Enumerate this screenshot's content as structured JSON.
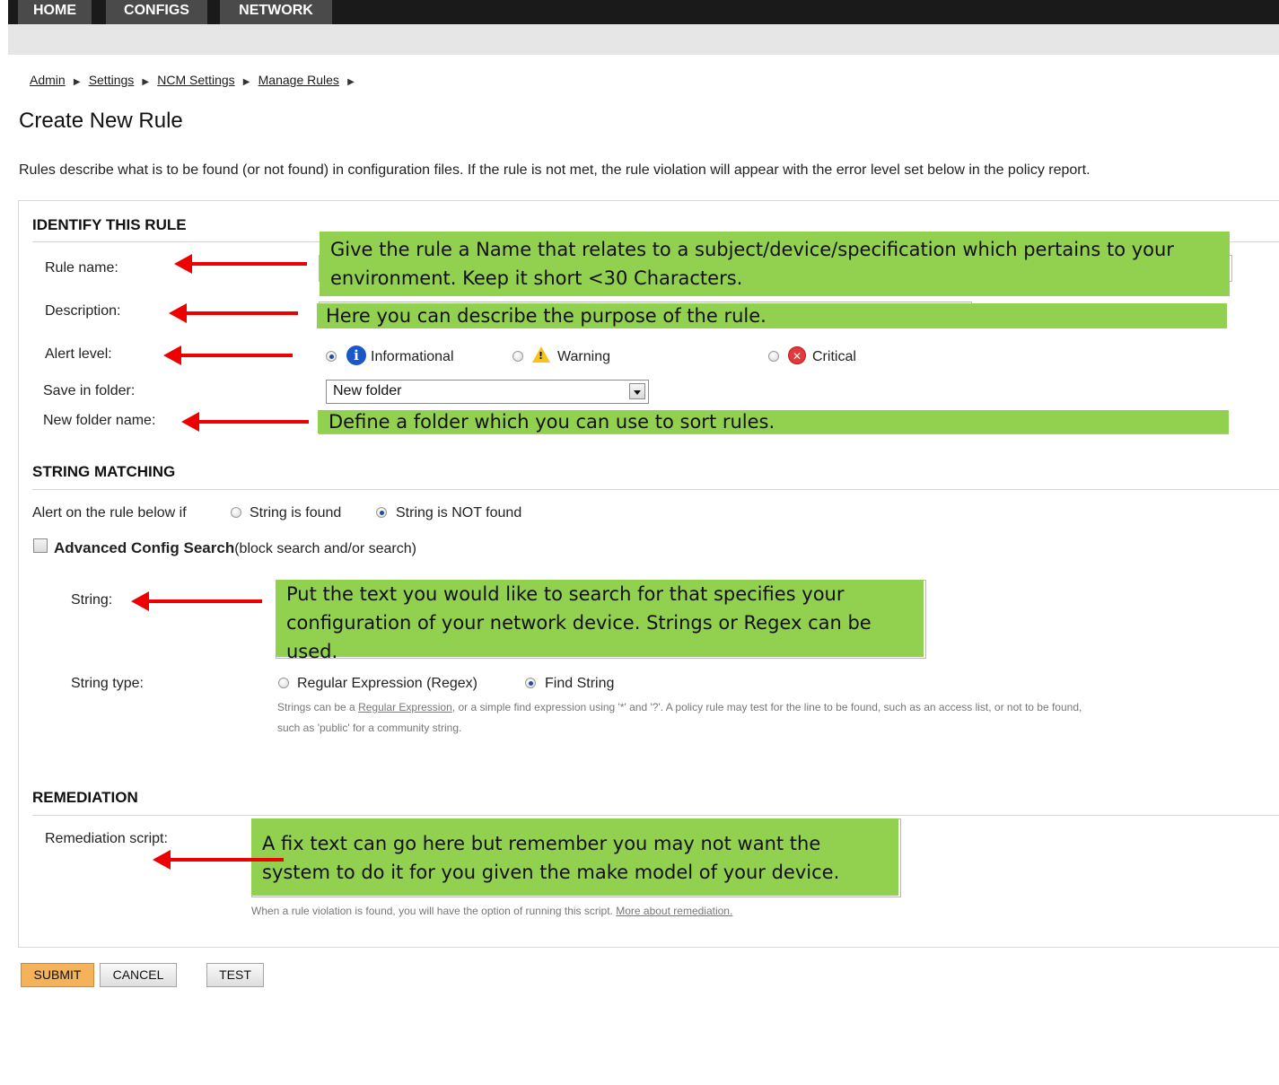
{
  "nav": {
    "tabs": [
      "HOME",
      "CONFIGS",
      "NETWORK"
    ]
  },
  "breadcrumb": [
    "Admin",
    "Settings",
    "NCM Settings",
    "Manage Rules"
  ],
  "page": {
    "title": "Create New Rule",
    "intro": "Rules describe what is to be found (or not found) in configuration files. If the rule is not met, the rule violation will appear with the error level set below in the policy report."
  },
  "identify": {
    "heading": "IDENTIFY THIS RULE",
    "rule_name_label": "Rule name:",
    "description_label": "Description:",
    "alert_level_label": "Alert level:",
    "alert_levels": [
      "Informational",
      "Warning",
      "Critical"
    ],
    "alert_level_selected": "Informational",
    "save_in_folder_label": "Save in folder:",
    "save_in_folder_value": "New folder",
    "new_folder_label": "New folder name:"
  },
  "string_matching": {
    "heading": "STRING MATCHING",
    "alert_if_label": "Alert on the rule below if",
    "alert_if_options": [
      "String is found",
      "String is NOT found"
    ],
    "alert_if_selected": "String is NOT found",
    "advanced_bold": "Advanced Config Search",
    "advanced_rest": "(block search and/or search)",
    "string_label": "String:",
    "string_type_label": "String type:",
    "string_type_options": [
      "Regular Expression (Regex)",
      "Find String"
    ],
    "string_type_selected": "Find String",
    "help_prefix": "Strings can be a ",
    "help_link": "Regular Expression",
    "help_line1_rest": ", or a simple find expression using '*' and '?'. A policy rule may test for the line to be found, such as an access list, or not to be found,",
    "help_line2": "such as 'public' for a community string."
  },
  "remediation": {
    "heading": "REMEDIATION",
    "script_label": "Remediation script:",
    "help_prefix": "When a rule violation is found, you will have the option of running this script. ",
    "help_link": "More about remediation."
  },
  "callouts": {
    "rule_name": "Give the rule a Name that relates to a subject/device/specification which pertains to your environment.  Keep it short <30 Characters.",
    "description": "Here you can describe the purpose of the rule.",
    "new_folder": "Define a folder which you can use to sort rules.",
    "string": "Put the text you would like to search for that specifies your configuration of your network device.  Strings or Regex can be used.",
    "remediation": "A fix text can go here but remember you may not want the system to do it for you given the make model of your device."
  },
  "buttons": {
    "submit": "SUBMIT",
    "cancel": "CANCEL",
    "test": "TEST"
  },
  "colors": {
    "callout_green": "#92d050",
    "arrow_red": "#ee0000",
    "submit_orange": "#f4b35a"
  }
}
